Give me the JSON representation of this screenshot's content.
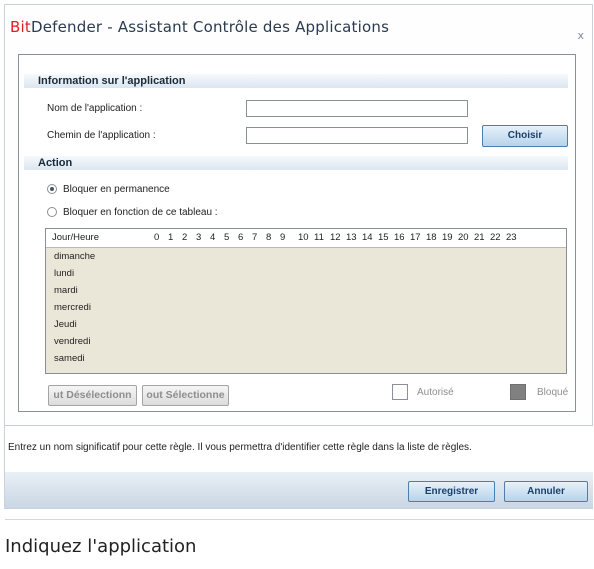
{
  "window": {
    "title_brand": "Bit",
    "title_rest": "Defender - Assistant Contrôle des Applications",
    "close_glyph": "x"
  },
  "app_info": {
    "header": "Information sur l'application",
    "name_label": "Nom de l'application :",
    "name_value": "",
    "path_label": "Chemin de l'application :",
    "path_value": "",
    "choose_button": "Choisir"
  },
  "action": {
    "header": "Action",
    "radio_block_always": "Bloquer en permanence",
    "radio_block_schedule": "Bloquer en fonction de ce tableau :",
    "selected": "block_always"
  },
  "schedule": {
    "corner_label": "Jour/Heure",
    "hours": [
      "0",
      "1",
      "2",
      "3",
      "4",
      "5",
      "6",
      "7",
      "8",
      "9",
      "10",
      "11",
      "12",
      "13",
      "14",
      "15",
      "16",
      "17",
      "18",
      "19",
      "20",
      "21",
      "22",
      "23"
    ],
    "days": [
      "dimanche",
      "lundi",
      "mardi",
      "mercredi",
      "Jeudi",
      "vendredi",
      "samedi"
    ]
  },
  "controls": {
    "deselect_all": "ut Désélectionn",
    "select_all": "out Sélectionne",
    "legend_allowed": "Autorisé",
    "legend_blocked": "Bloqué"
  },
  "hint": {
    "text": "Entrez un nom significatif pour cette règle. Il vous permettra d'identifier cette règle dans la liste de règles."
  },
  "footer": {
    "save": "Enregistrer",
    "cancel": "Annuler"
  },
  "caption": "Indiquez l'application",
  "colors": {
    "brand_red": "#e41b23",
    "allowed_legend": "#ffffff",
    "blocked_legend": "#808080",
    "grid_background": "#ebe7d8"
  }
}
